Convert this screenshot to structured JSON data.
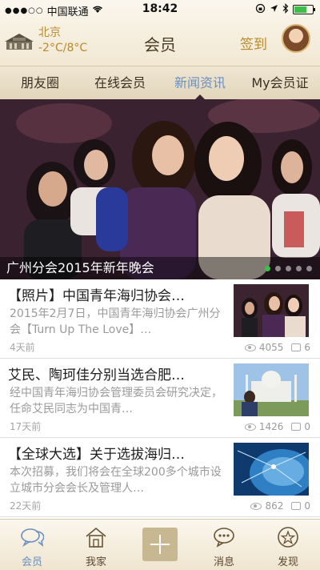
{
  "status": {
    "carrier": "中国联通",
    "time": "18:42"
  },
  "header": {
    "city": "北京",
    "temperature": "-2°C/8°C",
    "title": "会员",
    "checkin": "签到"
  },
  "tabs": [
    "朋友圈",
    "在线会员",
    "新闻资讯",
    "My会员证"
  ],
  "banner": {
    "caption": "广州分会2015年新年晚会",
    "slide_index": 1,
    "slide_count": 5
  },
  "news": [
    {
      "title": "【照片】中国青年海归协会…",
      "summary": "2015年2月7日，中国青年海归协会广州分会【Turn Up The Love】…",
      "time": "4天前",
      "views": "4055",
      "comments": "6"
    },
    {
      "title": "艾民、陶珂佳分别当选合肥…",
      "summary": "经中国青年海归协会管理委员会研究决定，任命艾民同志为中国青…",
      "time": "17天前",
      "views": "1426",
      "comments": "0"
    },
    {
      "title": "【全球大选】关于选拔海归…",
      "summary": "本次招募，我们将会在全球200多个城市设立城市分会会长及管理人…",
      "time": "22天前",
      "views": "862",
      "comments": "0"
    }
  ],
  "tabbar": [
    "会员",
    "我家",
    "消息",
    "发现"
  ]
}
